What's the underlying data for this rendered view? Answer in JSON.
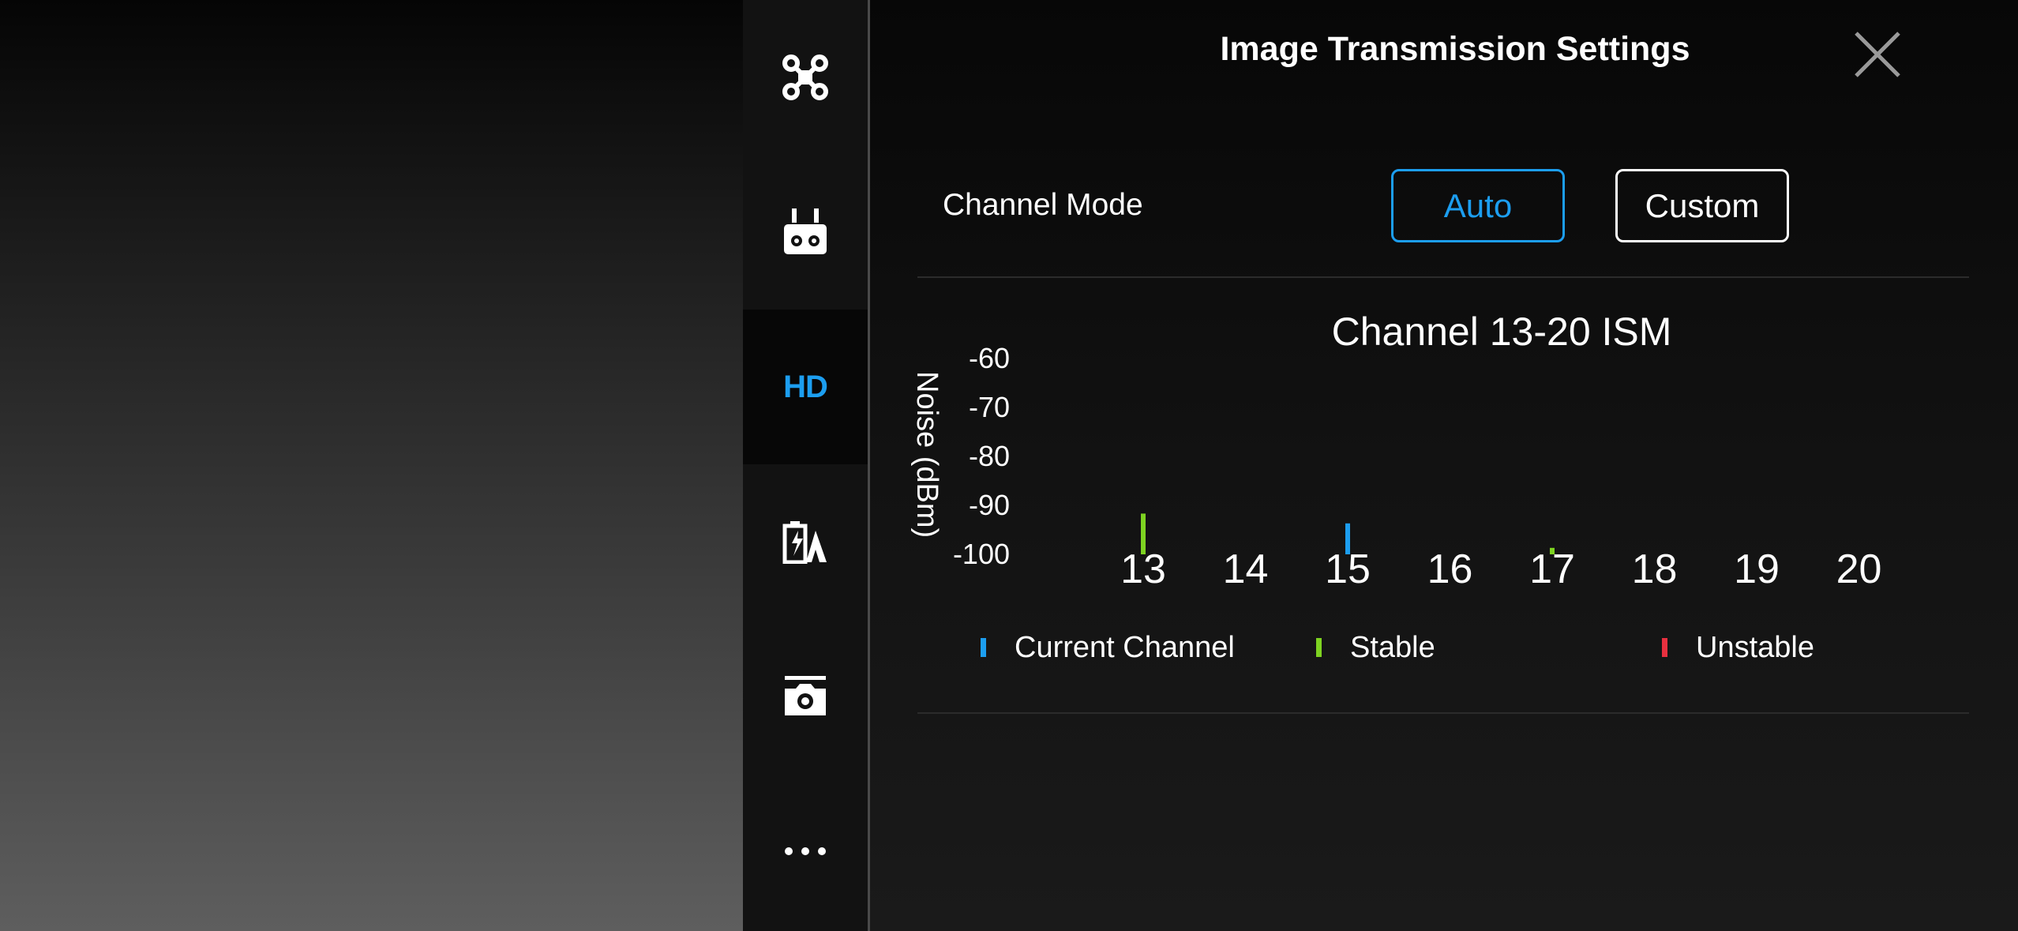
{
  "panel": {
    "title": "Image Transmission Settings"
  },
  "sidebar": {
    "items": [
      {
        "icon": "drone-icon"
      },
      {
        "icon": "remote-controller-icon"
      },
      {
        "icon": "hd-icon",
        "label": "HD",
        "active": true
      },
      {
        "icon": "battery-aircraft-icon"
      },
      {
        "icon": "camera-icon"
      },
      {
        "icon": "more-icon"
      }
    ]
  },
  "channel_mode": {
    "label": "Channel Mode",
    "options": [
      "Auto",
      "Custom"
    ],
    "selected": "Auto"
  },
  "colors": {
    "accent": "#1c9ef0",
    "stable": "#7ed321",
    "unstable": "#e8303f",
    "current": "#1c9ef0"
  },
  "chart_data": {
    "type": "bar",
    "title": "Channel 13-20 ISM",
    "ylabel": "Noise (dBm)",
    "xlabel": "",
    "ylim": [
      -100,
      -60
    ],
    "yticks": [
      "-60",
      "-70",
      "-80",
      "-90",
      "-100"
    ],
    "categories": [
      "13",
      "14",
      "15",
      "16",
      "17",
      "18",
      "19",
      "20"
    ],
    "values": [
      -92,
      null,
      -94,
      null,
      -99,
      null,
      null,
      null
    ],
    "status": [
      "stable",
      null,
      "current",
      null,
      "stable",
      null,
      null,
      null
    ],
    "legend": [
      {
        "label": "Current Channel",
        "status": "current"
      },
      {
        "label": "Stable",
        "status": "stable"
      },
      {
        "label": "Unstable",
        "status": "unstable"
      }
    ]
  }
}
